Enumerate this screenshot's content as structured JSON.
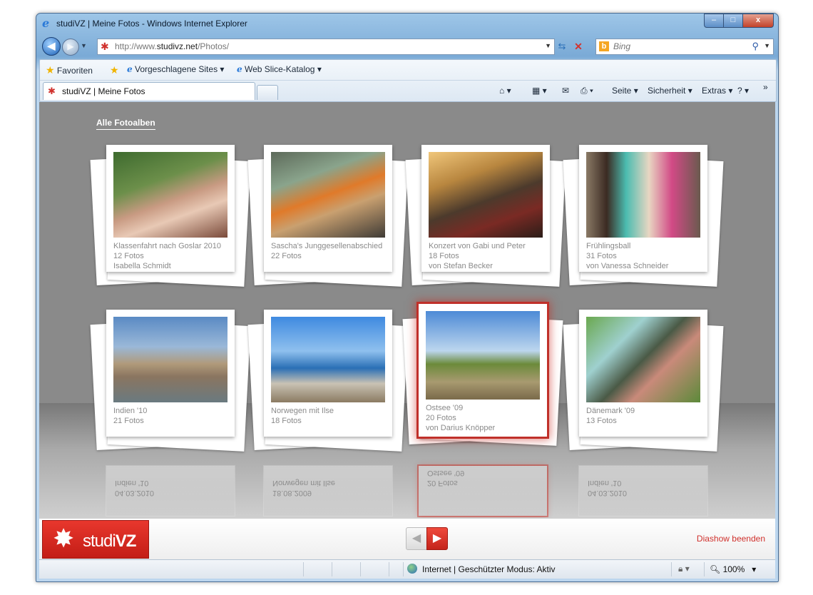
{
  "window": {
    "title": "studiVZ | Meine Fotos - Windows Internet Explorer",
    "controls": [
      "–",
      "□",
      "x"
    ]
  },
  "nav": {
    "url_prefix": "http://www.",
    "url_domain": "studivz.net",
    "url_path": "/Photos/",
    "search_placeholder": "Bing"
  },
  "favorites": {
    "label": "Favoriten",
    "suggested": "Vorgeschlagene Sites",
    "webslice": "Web Slice-Katalog"
  },
  "tab": {
    "label": "studiVZ | Meine Fotos"
  },
  "commands": {
    "page": "Seite",
    "security": "Sicherheit",
    "extras": "Extras"
  },
  "content": {
    "all_albums": "Alle Fotoalben",
    "albums": [
      {
        "title": "Klassenfahrt nach Goslar 2010",
        "count": "12 Fotos",
        "owner": "Isabella Schmidt"
      },
      {
        "title": "Sascha's Junggesellenabschied",
        "count": "22 Fotos",
        "owner": ""
      },
      {
        "title": "Konzert von Gabi und Peter",
        "count": "18 Fotos",
        "owner": "von Stefan Becker"
      },
      {
        "title": "Frühlingsball",
        "count": "31 Fotos",
        "owner": "von Vanessa Schneider"
      },
      {
        "title": "Indien '10",
        "count": "21 Fotos",
        "owner": ""
      },
      {
        "title": "Norwegen mit Ilse",
        "count": "18 Fotos",
        "owner": ""
      },
      {
        "title": "Ostsee '09",
        "count": "20 Fotos",
        "owner": "von Darius Knöpper"
      },
      {
        "title": "Dänemark '09",
        "count": "13 Fotos",
        "owner": ""
      }
    ],
    "reflections": [
      {
        "date": "04.03.2010",
        "title": "Indien '10"
      },
      {
        "date": "18.08.2009",
        "title": "Norwegen mit Ilse"
      },
      {
        "date": "20 Fotos",
        "title": "Ostsee '09"
      },
      {
        "date": "04.03.2010",
        "title": "Indien '10"
      }
    ]
  },
  "footer": {
    "logo": "studi",
    "logo_bold": "VZ",
    "end_slideshow": "Diashow beenden"
  },
  "status": {
    "text": "Internet | Geschützter Modus: Aktiv",
    "zoom": "100%"
  },
  "colors": {
    "accent": "#d0312d",
    "background": "#8a8a8a"
  }
}
